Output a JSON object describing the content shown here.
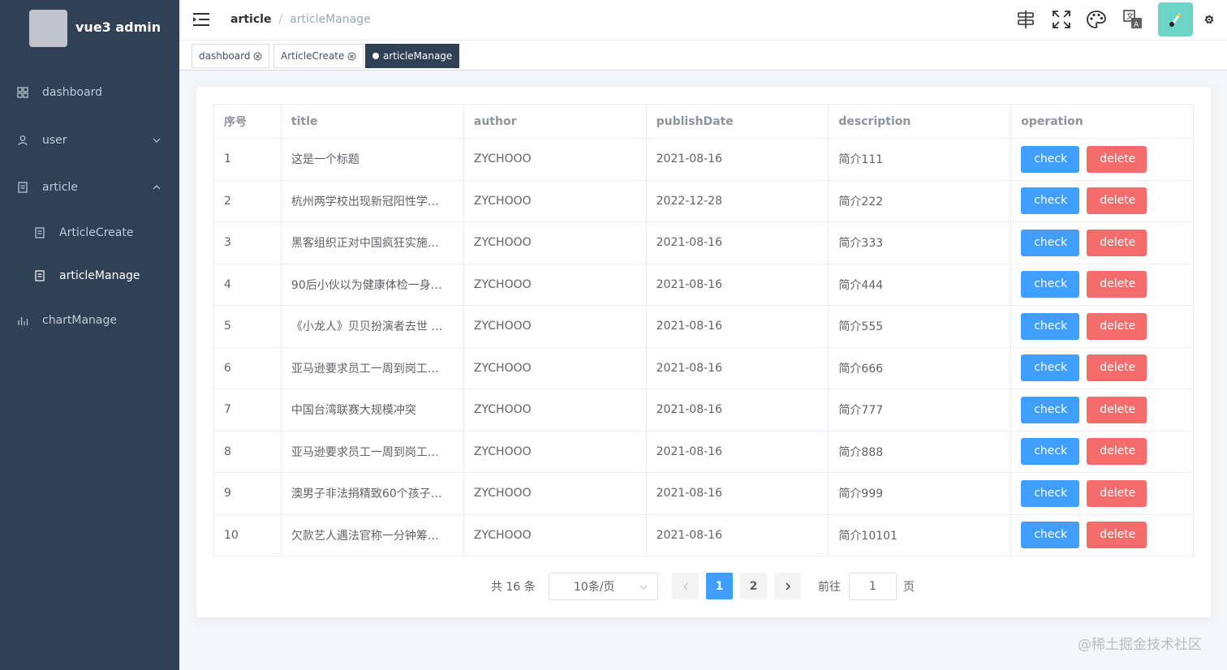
{
  "app": {
    "title": "vue3 admin"
  },
  "sidebar": {
    "items": [
      {
        "label": "dashboard",
        "icon": "dashboard-icon"
      },
      {
        "label": "user",
        "icon": "user-icon"
      },
      {
        "label": "article",
        "icon": "document-icon"
      },
      {
        "label": "ArticleCreate",
        "icon": "document-icon"
      },
      {
        "label": "articleManage",
        "icon": "document-icon"
      },
      {
        "label": "chartManage",
        "icon": "chart-icon"
      }
    ]
  },
  "header": {
    "breadcrumb": [
      "article",
      "articleManage"
    ],
    "icons": [
      "search-icon",
      "fullscreen-icon",
      "palette-icon",
      "translate-icon",
      "avatar-icon",
      "gear-icon"
    ]
  },
  "tags": [
    {
      "label": "dashboard",
      "active": false
    },
    {
      "label": "ArticleCreate",
      "active": false
    },
    {
      "label": "articleManage",
      "active": true
    }
  ],
  "table": {
    "columns": [
      "序号",
      "title",
      "author",
      "publishDate",
      "description",
      "operation"
    ],
    "rows": [
      {
        "no": "1",
        "title": "这是一个标题",
        "author": "ZYCHOOO",
        "date": "2021-08-16",
        "desc": "简介111"
      },
      {
        "no": "2",
        "title": "杭州两学校出现新冠阳性学…",
        "author": "ZYCHOOO",
        "date": "2022-12-28",
        "desc": "简介222"
      },
      {
        "no": "3",
        "title": "黑客组织正对中国疯狂实施…",
        "author": "ZYCHOOO",
        "date": "2021-08-16",
        "desc": "简介333"
      },
      {
        "no": "4",
        "title": "90后小伙以为健康体检一身…",
        "author": "ZYCHOOO",
        "date": "2021-08-16",
        "desc": "简介444"
      },
      {
        "no": "5",
        "title": "《小龙人》贝贝扮演者去世 …",
        "author": "ZYCHOOO",
        "date": "2021-08-16",
        "desc": "简介555"
      },
      {
        "no": "6",
        "title": "亚马逊要求员工一周到岗工…",
        "author": "ZYCHOOO",
        "date": "2021-08-16",
        "desc": "简介666"
      },
      {
        "no": "7",
        "title": "中国台湾联赛大规模冲突",
        "author": "ZYCHOOO",
        "date": "2021-08-16",
        "desc": "简介777"
      },
      {
        "no": "8",
        "title": "亚马逊要求员工一周到岗工…",
        "author": "ZYCHOOO",
        "date": "2021-08-16",
        "desc": "简介888"
      },
      {
        "no": "9",
        "title": "澳男子非法捐精致60个孩子…",
        "author": "ZYCHOOO",
        "date": "2021-08-16",
        "desc": "简介999"
      },
      {
        "no": "10",
        "title": "欠款艺人遇法官称一分钟筹…",
        "author": "ZYCHOOO",
        "date": "2021-08-16",
        "desc": "简介10101"
      }
    ],
    "check_label": "check",
    "delete_label": "delete"
  },
  "pagination": {
    "total": "共 16 条",
    "page_size": "10条/页",
    "pages": [
      "1",
      "2"
    ],
    "current": "1",
    "goto": "前往",
    "goto_value": "1",
    "page_suffix": "页"
  },
  "watermark": "@稀土掘金技术社区",
  "colors": {
    "sidebar": "#304156",
    "primary": "#409eff",
    "danger": "#f56c6c",
    "avatar_bg": "#6dd4c8"
  }
}
